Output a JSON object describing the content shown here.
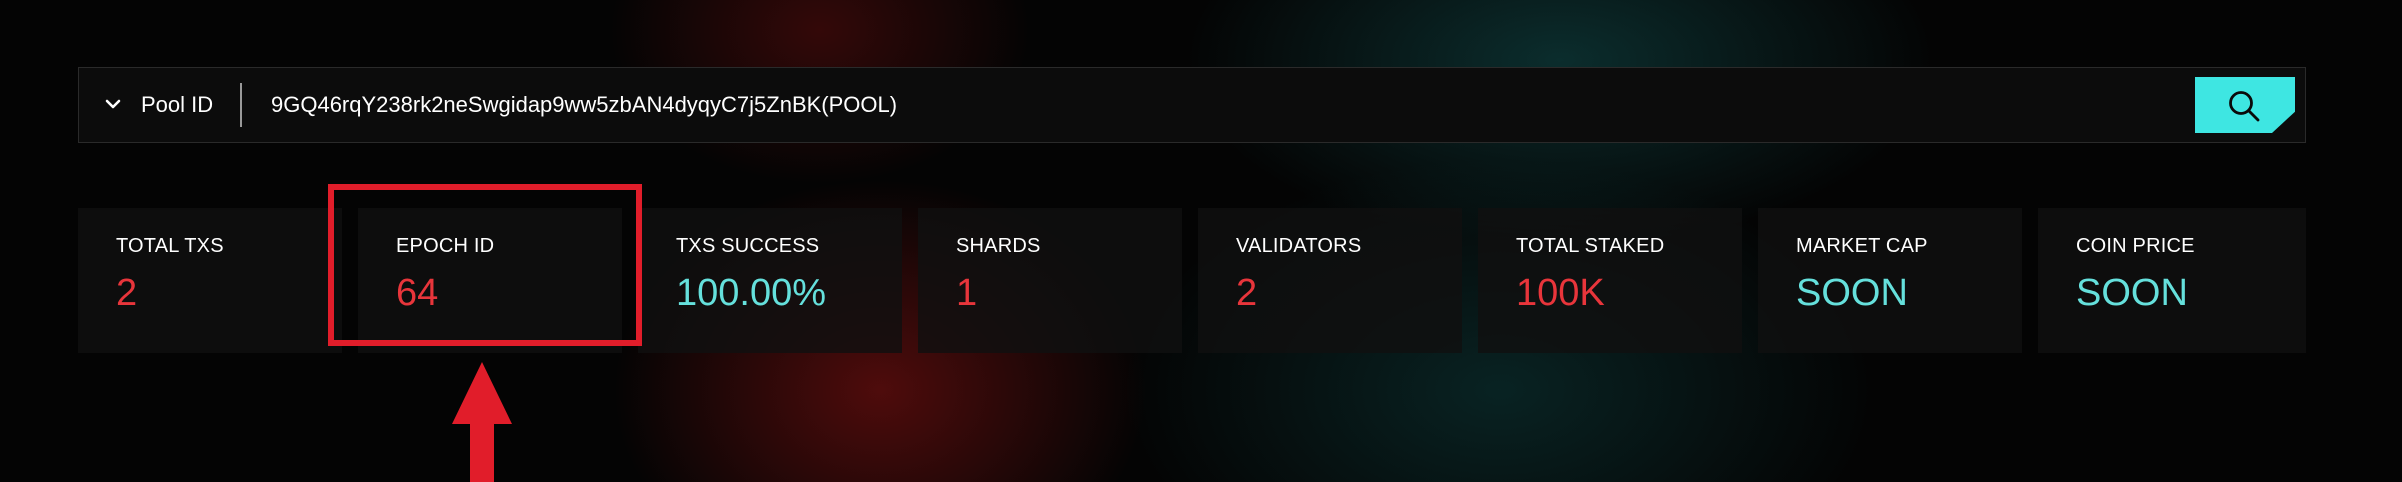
{
  "search": {
    "dropdown_label": "Pool ID",
    "value": "9GQ46rqY238rk2neSwgidap9ww5zbAN4dyqyC7j5ZnBK(POOL)",
    "dropdown_icon": "chevron-down-icon",
    "button_icon": "search-icon",
    "accent_color": "#3ee6e2"
  },
  "stats": [
    {
      "title": "TOTAL TXS",
      "value": "2",
      "color": "#e8353b"
    },
    {
      "title": "EPOCH ID",
      "value": "64",
      "color": "#e8353b"
    },
    {
      "title": "TXS SUCCESS",
      "value": "100.00%",
      "color": "#65e0dc"
    },
    {
      "title": "SHARDS",
      "value": "1",
      "color": "#e8353b"
    },
    {
      "title": "VALIDATORS",
      "value": "2",
      "color": "#e8353b"
    },
    {
      "title": "TOTAL STAKED",
      "value": "100K",
      "color": "#e8353b"
    },
    {
      "title": "MARKET CAP",
      "value": "SOON",
      "color": "#65e0dc"
    },
    {
      "title": "COIN PRICE",
      "value": "SOON",
      "color": "#65e0dc"
    }
  ],
  "annotation": {
    "highlight_color": "#e11d2a",
    "arrow_icon": "arrow-up-icon"
  }
}
